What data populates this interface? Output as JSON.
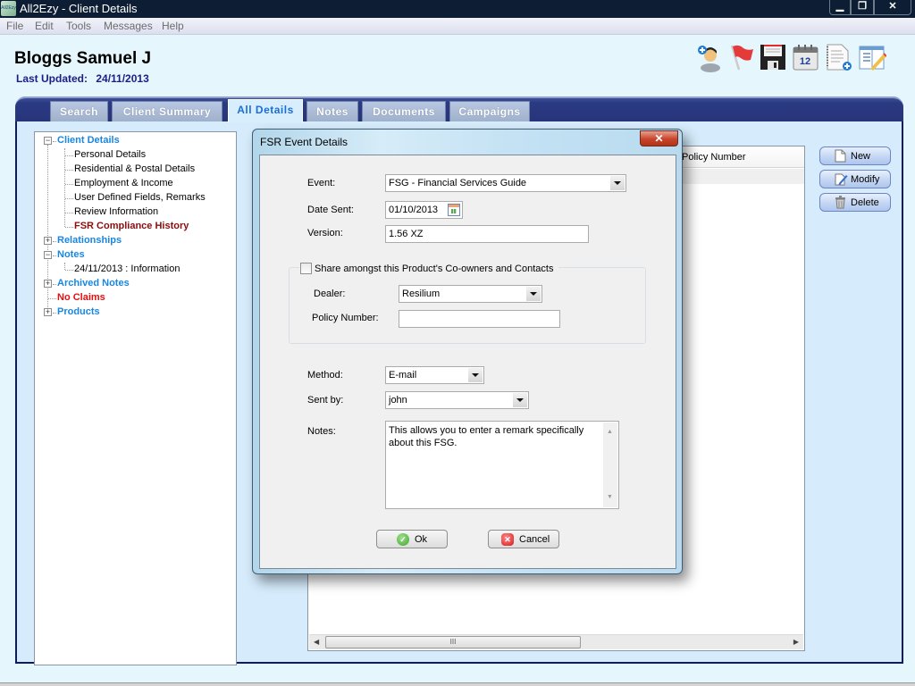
{
  "window": {
    "title": "All2Ezy - Client Details",
    "app_icon_text": "All2Ezy",
    "controls": {
      "minimize": "▁",
      "restore": "❐",
      "close": "✕"
    }
  },
  "menu": [
    "File",
    "Edit",
    "Tools",
    "Messages",
    "Help"
  ],
  "header": {
    "client_name": "Bloggs Samuel J",
    "last_updated_label": "Last Updated:",
    "last_updated_value": "24/11/2013"
  },
  "toolbar": {
    "icons": [
      "add-contact-icon",
      "flag-icon",
      "save-icon",
      "calendar-icon",
      "add-document-icon",
      "edit-form-icon"
    ],
    "calendar_day": "12"
  },
  "tabs": [
    {
      "label": "Search",
      "active": false
    },
    {
      "label": "Client Summary",
      "active": false
    },
    {
      "label": "All Details",
      "active": true
    },
    {
      "label": "Notes",
      "active": false
    },
    {
      "label": "Documents",
      "active": false
    },
    {
      "label": "Campaigns",
      "active": false
    }
  ],
  "tree": {
    "client_details": {
      "label": "Client Details",
      "expander": "−",
      "children": [
        "Personal Details",
        "Residential & Postal Details",
        "Employment & Income",
        "User Defined Fields, Remarks",
        "Review Information",
        "FSR Compliance History"
      ]
    },
    "relationships": {
      "label": "Relationships",
      "expander": "+"
    },
    "notes": {
      "label": "Notes",
      "expander": "−",
      "children": [
        "24/11/2013 : Information"
      ]
    },
    "archived_notes": {
      "label": "Archived Notes",
      "expander": "+"
    },
    "no_claims": {
      "label": "No Claims"
    },
    "products": {
      "label": "Products",
      "expander": "+"
    }
  },
  "grid": {
    "columns": [
      "Policy Number"
    ],
    "scroll_thumb_glyph": "III",
    "scroll_left": "◀",
    "scroll_right": "▶"
  },
  "side_buttons": {
    "new": "New",
    "modify": "Modify",
    "delete": "Delete"
  },
  "dialog": {
    "title": "FSR Event Details",
    "close_glyph": "✕",
    "event": {
      "label": "Event:",
      "value": "FSG - Financial Services Guide"
    },
    "date_sent": {
      "label": "Date Sent:",
      "value": "01/10/2013"
    },
    "version": {
      "label": "Version:",
      "value": "1.56 XZ"
    },
    "share": {
      "label": "Share amongst this Product's Co-owners and Contacts",
      "checked": false
    },
    "dealer": {
      "label": "Dealer:",
      "value": "Resilium"
    },
    "policy_number": {
      "label": "Policy Number:",
      "value": ""
    },
    "method": {
      "label": "Method:",
      "value": "E-mail"
    },
    "sent_by": {
      "label": "Sent by:",
      "value": "john"
    },
    "notes": {
      "label": "Notes:",
      "value": "This allows you to enter a remark specifically about this FSG."
    },
    "scroll_up": "▲",
    "scroll_down": "▼",
    "ok": {
      "label": "Ok",
      "icon": "✓"
    },
    "cancel": {
      "label": "Cancel",
      "icon": "✕"
    }
  }
}
